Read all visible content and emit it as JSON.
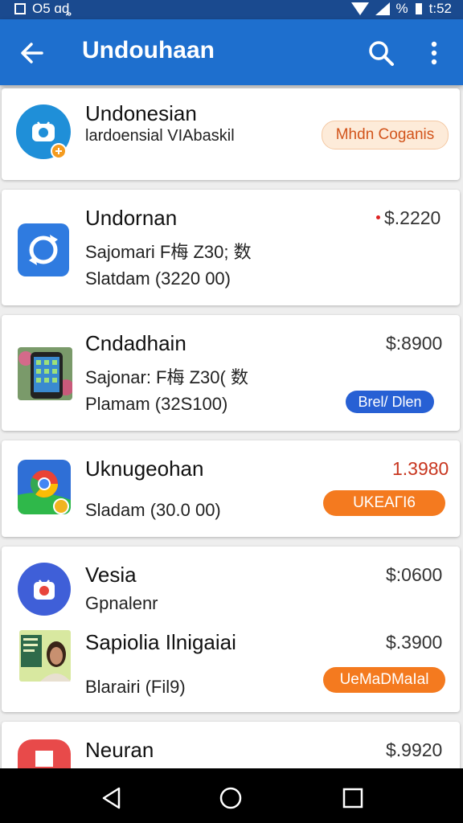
{
  "status_bar": {
    "left_text": "O5 ɑȡ",
    "battery_text": "%",
    "time": "t:52"
  },
  "app_bar": {
    "title": "Undouhaan"
  },
  "items": [
    {
      "title": "Undonesian",
      "subtitle": "lardoensial VIAbaskil",
      "badge": "Mhdn Coganis"
    },
    {
      "title": "Undornan",
      "price": "$.2220",
      "line2": "Sajomari F梅 Z30; 数",
      "line3": "Slatdam (3220 00)"
    },
    {
      "title": "Cndadhain",
      "price": "$:8900",
      "line2": "Sajonar: F梅 Z30( 数",
      "line3": "Plamam (32S100)",
      "badge": "Brel/ Dlen"
    },
    {
      "title": "Uknugeohan",
      "price": "1.3980",
      "line2": "Sladam (30.0 00)",
      "badge": "UKEAГІ6"
    },
    {
      "title": "Vesia",
      "price": "$:0600",
      "line2": "Gpnalenr",
      "title2": "Sapiolia Ilnigaiai",
      "price2": "$.3900",
      "line3": "Blarairi (Fil9)",
      "badge": "UeMaDMaIal"
    },
    {
      "title": "Neuran",
      "price": "$.9920"
    }
  ],
  "colors": {
    "app_bar": "#1e6fce",
    "status_bar": "#1a4a8f",
    "orange_badge": "#f47a1f",
    "blue_badge": "#2760d4"
  }
}
